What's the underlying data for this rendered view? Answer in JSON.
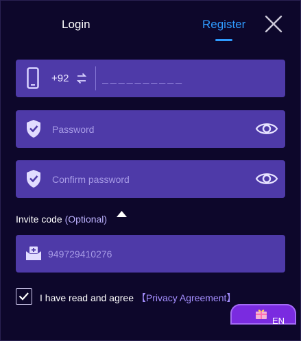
{
  "tabs": {
    "login": "Login",
    "register": "Register"
  },
  "phone": {
    "country_code": "+92",
    "placeholder": "__________"
  },
  "password": {
    "placeholder": "Password"
  },
  "confirm_password": {
    "placeholder": "Confirm password"
  },
  "invite": {
    "label": "Invite code",
    "optional": "(Optional)",
    "placeholder": "949729410276"
  },
  "agreement": {
    "text": "I have read and agree",
    "link": "【Privacy Agreement】",
    "checked": true
  },
  "language": "EN",
  "icons": {
    "close": "close-icon",
    "phone": "mobile-phone-icon",
    "swap": "swap-arrows-icon",
    "shield": "shield-check-icon",
    "eye": "eye-icon",
    "invite": "invite-mail-icon",
    "caret": "caret-up-icon",
    "check": "check-icon",
    "gift": "gift-icon"
  },
  "colors": {
    "background": "#0d072b",
    "field": "#4e3aa8",
    "accent": "#2f9bff",
    "link": "#a58fff"
  }
}
